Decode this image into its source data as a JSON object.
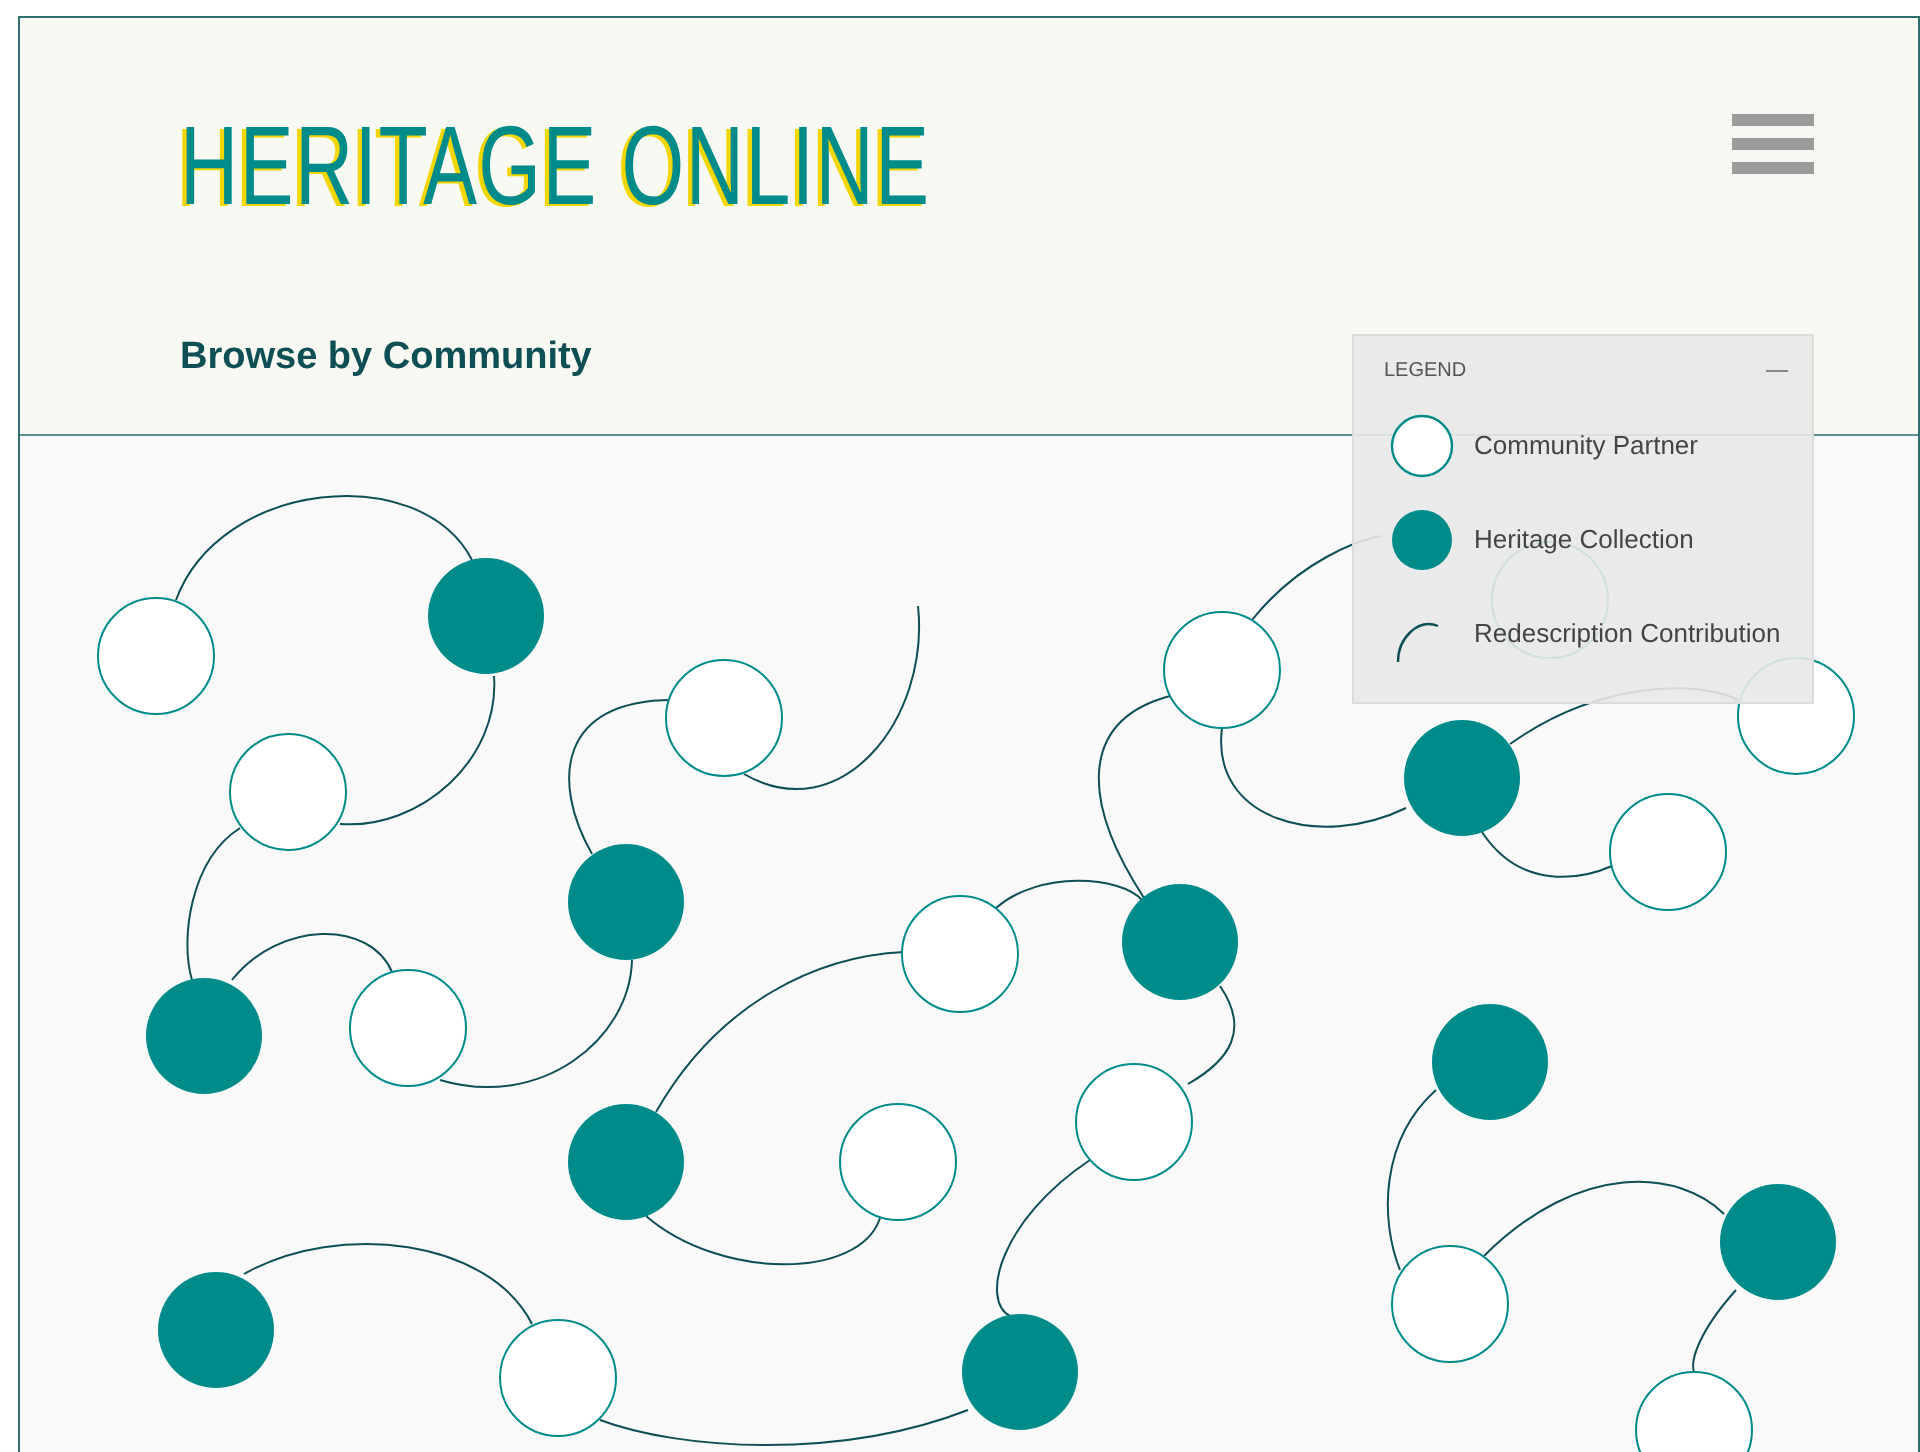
{
  "header": {
    "logo": "HERITAGE ONLINE",
    "title": "Browse by Community"
  },
  "legend": {
    "title": "LEGEND",
    "items": [
      {
        "kind": "partner",
        "label": "Community Partner"
      },
      {
        "kind": "collection",
        "label": "Heritage Collection"
      },
      {
        "kind": "contribution",
        "label": "Redescription Contribution"
      }
    ]
  }
}
